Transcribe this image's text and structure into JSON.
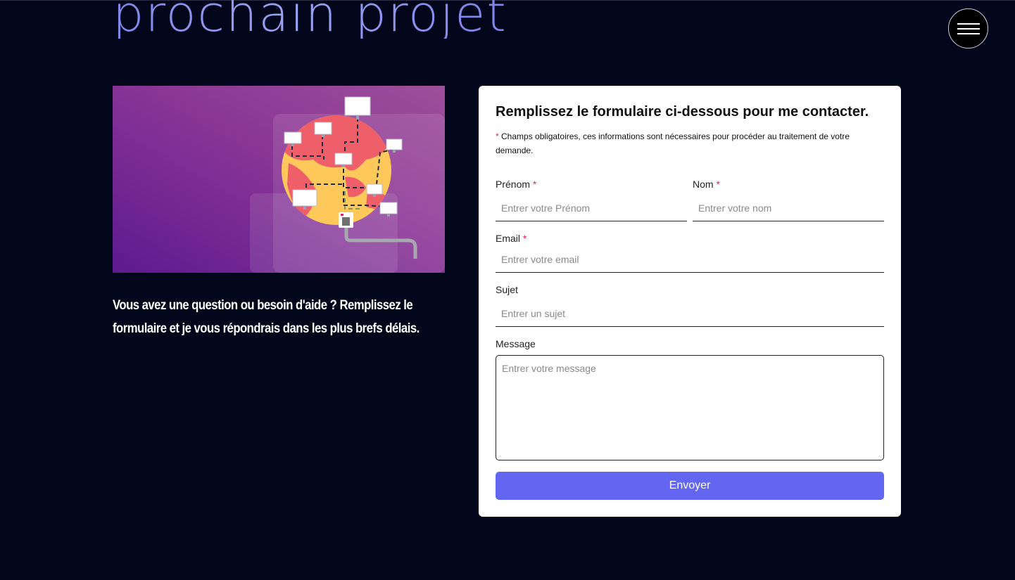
{
  "header": {
    "title": "prochain projet",
    "menu_icon": "hamburger-menu-icon"
  },
  "illustration": {
    "icon": "network-globe-illustration",
    "colors": {
      "background": "#7a2a96",
      "globe_land": "#ee5f6a",
      "globe_ocean": "#ffc85a"
    }
  },
  "intro": {
    "text": "Vous avez une question ou besoin d'aide ? Remplissez le formulaire et je vous répondrais dans les plus brefs délais."
  },
  "form": {
    "title": "Remplissez le formulaire ci-dessous pour me contacter.",
    "required_star": "*",
    "required_note": "Champs obligatoires, ces informations sont nécessaires pour procéder au traitement de votre demande.",
    "firstname": {
      "label": "Prénom",
      "placeholder": "Entrer votre Prénom"
    },
    "lastname": {
      "label": "Nom",
      "placeholder": "Entrer votre nom"
    },
    "email": {
      "label": "Email",
      "placeholder": "Entrer votre email"
    },
    "subject": {
      "label": "Sujet",
      "placeholder": "Entrer un sujet"
    },
    "message": {
      "label": "Message",
      "placeholder": "Entrer votre message"
    },
    "submit_label": "Envoyer"
  },
  "colors": {
    "page_background": "#02061a",
    "accent": "#6366f1",
    "required": "#e0245e",
    "title_gradient_start": "#7f86e6",
    "title_gradient_end": "#9aa3f4"
  }
}
